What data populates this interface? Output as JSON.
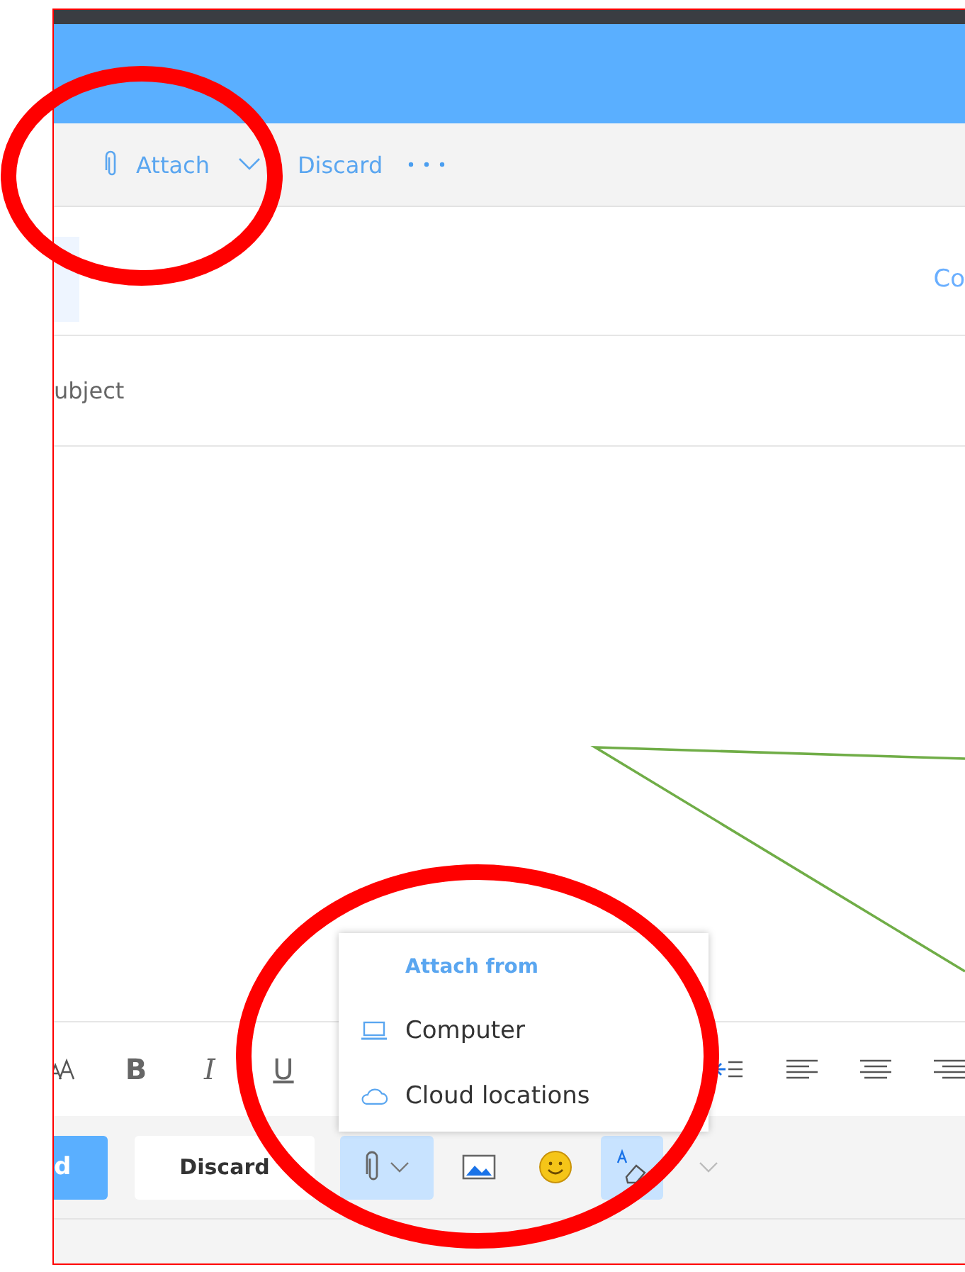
{
  "top_toolbar": [
    {
      "kind": "attach",
      "label": "Attach"
    },
    {
      "kind": "discard",
      "label": "Discard"
    },
    {
      "kind": "more"
    }
  ],
  "recipients": {
    "link": "Co"
  },
  "subject": {
    "placeholder": "ubject"
  },
  "format_toolbar": [
    {
      "kind": "font-size"
    },
    {
      "kind": "bold",
      "label": "B"
    },
    {
      "kind": "italic",
      "label": "I"
    },
    {
      "kind": "underline",
      "label": "U"
    },
    {
      "kind": "indent"
    },
    {
      "kind": "align-left"
    },
    {
      "kind": "align-center"
    },
    {
      "kind": "align-right"
    }
  ],
  "bottom_bar": {
    "send": {
      "label": "d"
    },
    "discard": {
      "label": "Discard"
    },
    "tools": [
      {
        "kind": "attach",
        "on": true
      },
      {
        "kind": "image",
        "on": false
      },
      {
        "kind": "emoji",
        "on": false
      },
      {
        "kind": "format-painter",
        "on": true
      },
      {
        "kind": "chevron",
        "on": false
      }
    ]
  },
  "attach_menu": {
    "title": "Attach from",
    "items": [
      {
        "kind": "computer",
        "label": "Computer"
      },
      {
        "kind": "cloud",
        "label": "Cloud locations"
      }
    ]
  },
  "annotations": [
    {
      "kind": "ellipse",
      "color": "#ff0000"
    },
    {
      "kind": "ellipse",
      "color": "#ff0000"
    },
    {
      "kind": "callout",
      "color": "#70ad47"
    }
  ]
}
